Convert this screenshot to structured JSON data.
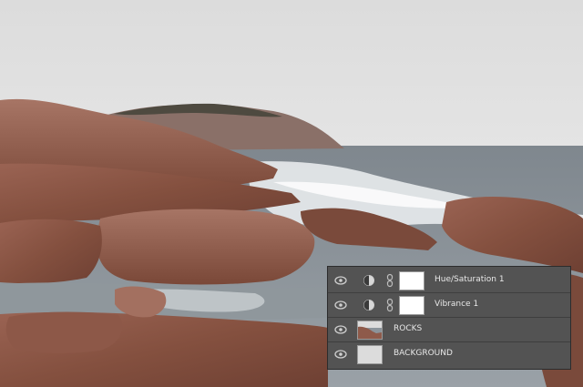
{
  "layers_panel": {
    "layers": [
      {
        "name": "Hue/Saturation 1",
        "type": "adjustment",
        "visible": true
      },
      {
        "name": "Vibrance 1",
        "type": "adjustment",
        "visible": true
      },
      {
        "name": "ROCKS",
        "type": "image",
        "visible": true
      },
      {
        "name": "BACKGROUND",
        "type": "image",
        "visible": true
      }
    ]
  },
  "colors": {
    "sky": "#dfdfdf",
    "sea": "#8c949b",
    "rock": "#8e5a4a",
    "panel_bg": "#535353",
    "panel_text": "#e8e8e8"
  }
}
